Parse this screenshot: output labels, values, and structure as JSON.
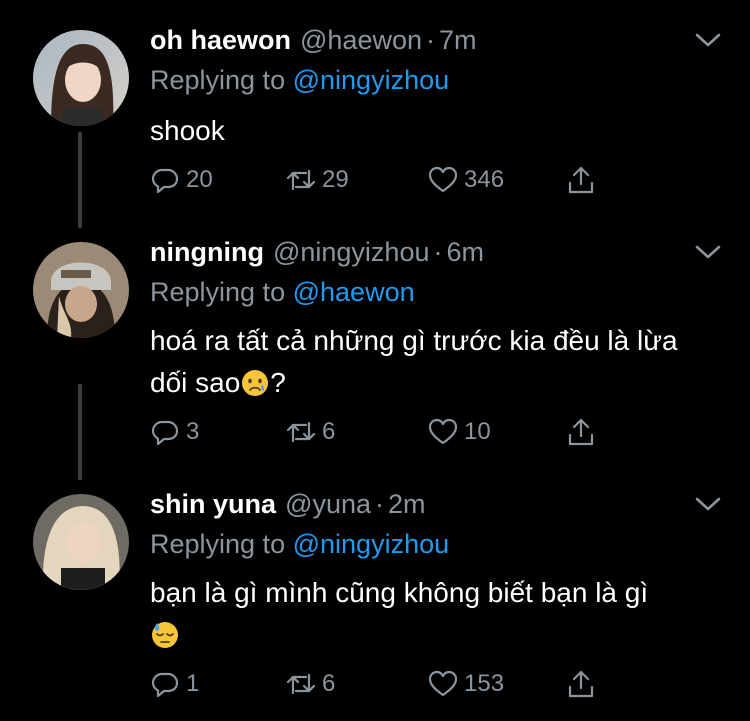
{
  "tweets": [
    {
      "name": "oh haewon",
      "handle": "@haewon",
      "separator": "·",
      "time": "7m",
      "replying_prefix": "Replying to",
      "replying_to": "@ningyizhou",
      "body": "shook",
      "replies": "20",
      "retweets": "29",
      "likes": "346"
    },
    {
      "name": "ningning",
      "handle": "@ningyizhou",
      "separator": "·",
      "time": "6m",
      "replying_prefix": "Replying to",
      "replying_to": "@haewon",
      "body_line1": "hoá ra tất cả những gì trước kia đều là lừa",
      "body_line2a": "dối sao",
      "body_line2b": "?",
      "emoji_name": "crying-face",
      "replies": "3",
      "retweets": "6",
      "likes": "10"
    },
    {
      "name": "shin yuna",
      "handle": "@yuna",
      "separator": "·",
      "time": "2m",
      "replying_prefix": "Replying to",
      "replying_to": "@ningyizhou",
      "body_line1": "bạn là gì mình cũng không biết bạn là gì",
      "emoji_name": "downcast-face-with-sweat",
      "replies": "1",
      "retweets": "6",
      "likes": "153"
    }
  ],
  "colors": {
    "background": "#000000",
    "text": "#ffffff",
    "muted": "#8b959e",
    "link": "#1d9bf0",
    "thread_line": "#3a3d40"
  },
  "icons": [
    "reply-icon",
    "retweet-icon",
    "like-icon",
    "share-icon",
    "chevron-down-icon"
  ]
}
